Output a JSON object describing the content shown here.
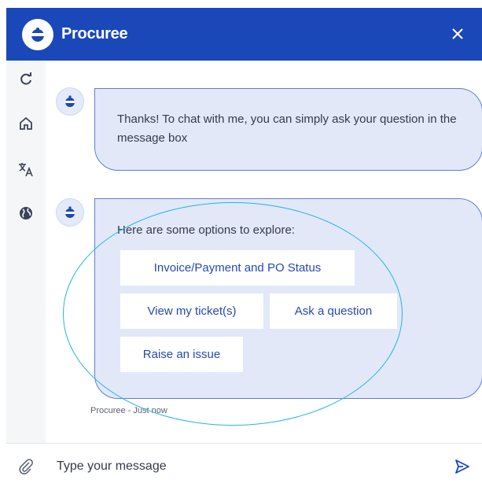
{
  "header": {
    "title": "Procuree",
    "close_icon": "close-icon",
    "color": "#1b48b8"
  },
  "rail": {
    "icons": [
      "refresh-icon",
      "home-icon",
      "translate-icon",
      "globe-icon"
    ]
  },
  "messages": [
    {
      "sender": "bot",
      "text": "Thanks! To chat with me, you can simply ask your question in the message box"
    },
    {
      "sender": "bot",
      "intro": "Here are some options to explore:",
      "options": [
        "Invoice/Payment and PO Status",
        "View my ticket(s)",
        "Ask a question",
        "Raise an issue"
      ],
      "meta": "Procuree - Just now"
    }
  ],
  "composer": {
    "placeholder": "Type your message",
    "attach_icon": "paperclip-icon",
    "send_icon": "send-icon"
  },
  "colors": {
    "bubble": "#e2e8f8",
    "bubble_border": "#5f7fd0",
    "option_text": "#2748b0",
    "annotation": "#24b4e4"
  }
}
